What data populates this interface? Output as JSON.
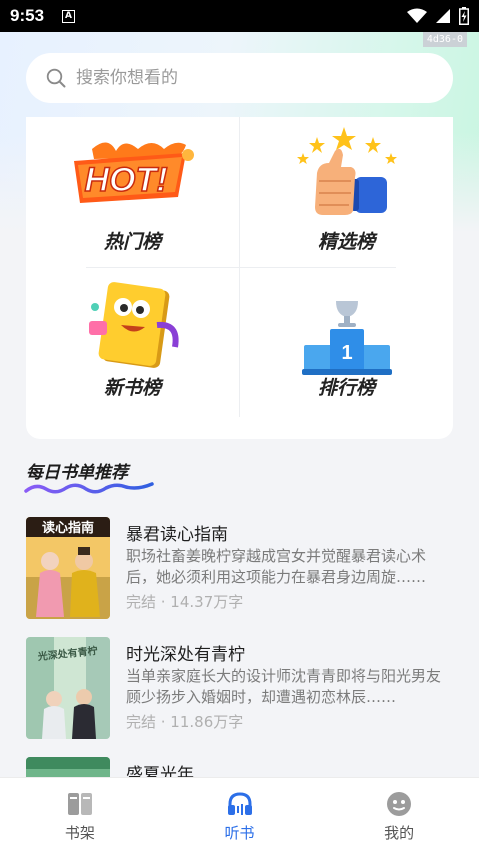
{
  "status_bar": {
    "time": "9:53",
    "notification_icon": "A"
  },
  "debug_tag": "4d36-0",
  "search": {
    "placeholder": "搜索你想看的",
    "value": ""
  },
  "rankings": [
    {
      "label": "热门榜",
      "icon": "hot-icon"
    },
    {
      "label": "精选榜",
      "icon": "thumbs-up-icon"
    },
    {
      "label": "新书榜",
      "icon": "book-mascot-icon"
    },
    {
      "label": "排行榜",
      "icon": "podium-icon"
    }
  ],
  "hot_badge_text": "HOT!",
  "podium_number": "1",
  "daily": {
    "title": "每日书单推荐"
  },
  "books": [
    {
      "title": "暴君读心指南",
      "description": "职场社畜姜晚柠穿越成宫女并觉醒暴君读心术后，她必须利用这项能力在暴君身边周旋……",
      "status": "完结",
      "word_count": "14.37万字",
      "meta": "完结 · 14.37万字",
      "cover_text": "读心指南"
    },
    {
      "title": "时光深处有青柠",
      "description": "当单亲家庭长大的设计师沈青青即将与阳光男友顾少扬步入婚姻时，却遭遇初恋林辰……",
      "status": "完结",
      "word_count": "11.86万字",
      "meta": "完结 · 11.86万字",
      "cover_text": "光深处有青柠"
    },
    {
      "title": "盛夏光年"
    }
  ],
  "tabs": [
    {
      "label": "书架",
      "icon": "bookshelf-icon",
      "active": false
    },
    {
      "label": "听书",
      "icon": "headphones-icon",
      "active": true
    },
    {
      "label": "我的",
      "icon": "profile-face-icon",
      "active": false
    }
  ],
  "colors": {
    "accent": "#2c6fe8",
    "background": "#f3f4f7"
  }
}
